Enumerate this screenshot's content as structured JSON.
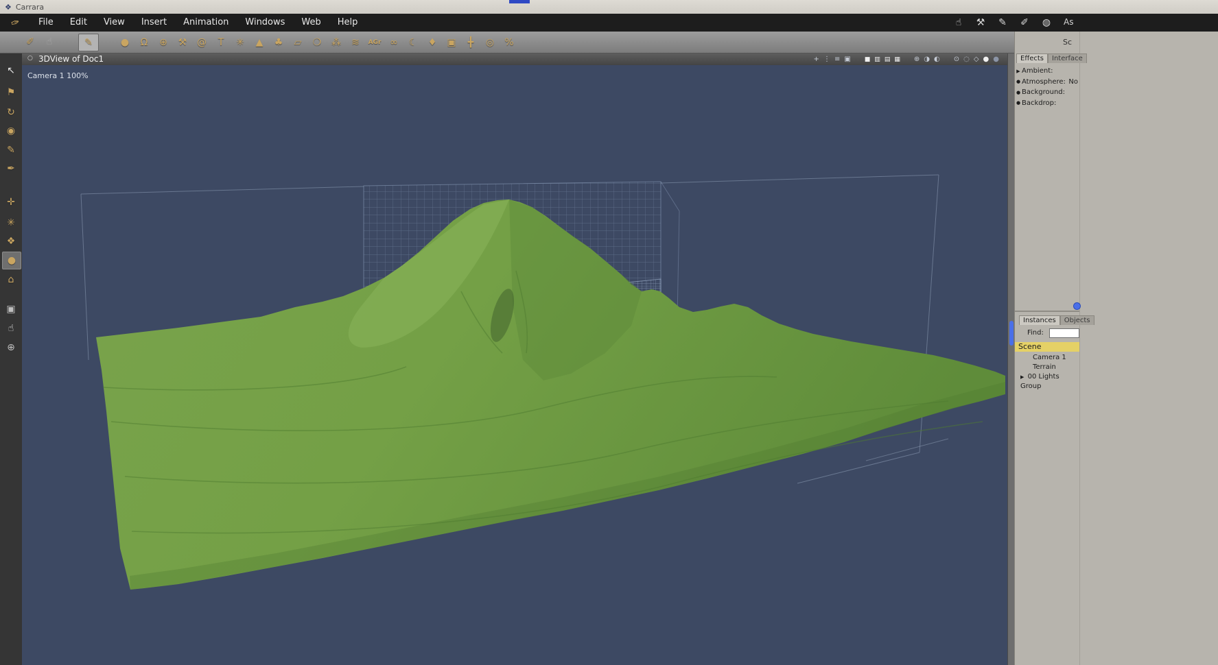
{
  "titlebar": {
    "title": "Carrara"
  },
  "menubar": {
    "brand_glyph": "✑",
    "items": [
      "File",
      "Edit",
      "View",
      "Insert",
      "Animation",
      "Windows",
      "Web",
      "Help"
    ],
    "room_label": "As",
    "room_icons": [
      {
        "name": "assemble-hand",
        "glyph": "☝"
      },
      {
        "name": "model-wrench",
        "glyph": "⚒"
      },
      {
        "name": "storyboard-pen",
        "glyph": "✎"
      },
      {
        "name": "texture-knife",
        "glyph": "✐"
      },
      {
        "name": "render-sphere",
        "glyph": "◍"
      }
    ]
  },
  "toolbar": {
    "edit_tools": [
      {
        "name": "wireframe-knife",
        "glyph": "✐"
      },
      {
        "name": "ghost-hand",
        "glyph": "☝"
      },
      {
        "name": "paint-brush",
        "glyph": "✎"
      }
    ],
    "tools": [
      {
        "name": "sphere-tool",
        "glyph": "●"
      },
      {
        "name": "vertical-object-tool",
        "glyph": "Ω"
      },
      {
        "name": "geodesic-tool",
        "glyph": "⊕"
      },
      {
        "name": "spline-tool",
        "glyph": "⚒"
      },
      {
        "name": "spiral-tool",
        "glyph": "@"
      },
      {
        "name": "text-tool",
        "glyph": "T"
      },
      {
        "name": "particle-tool",
        "glyph": "✳"
      },
      {
        "name": "terrain-tool",
        "glyph": "▲"
      },
      {
        "name": "plant-tool",
        "glyph": "♣"
      },
      {
        "name": "plane-tool",
        "glyph": "▱"
      },
      {
        "name": "ocean-tool",
        "glyph": "❍"
      },
      {
        "name": "rock-tool",
        "glyph": "⁂"
      },
      {
        "name": "cloud-tool",
        "glyph": "≋"
      },
      {
        "name": "agr-tool",
        "glyph": "AGr"
      },
      {
        "name": "metaball-tool",
        "glyph": "∞"
      },
      {
        "name": "shell-tool",
        "glyph": "☾"
      },
      {
        "name": "cone-tool",
        "glyph": "♦"
      },
      {
        "name": "camera-tool",
        "glyph": "▣"
      },
      {
        "name": "axes-tool",
        "glyph": "╋"
      },
      {
        "name": "target-tool",
        "glyph": "◎"
      },
      {
        "name": "bone-tool",
        "glyph": "%"
      }
    ]
  },
  "left_toolbar": [
    {
      "name": "select-arrow",
      "glyph": "↖"
    },
    {
      "name": "paint-flag",
      "glyph": "⚑"
    },
    {
      "name": "rotate-ring",
      "glyph": "↻"
    },
    {
      "name": "eye-sphere",
      "glyph": "◉"
    },
    {
      "name": "pen-tool",
      "glyph": "✎"
    },
    {
      "name": "screw-tool",
      "glyph": "✒"
    },
    {
      "name": "move-tool",
      "glyph": "✛"
    },
    {
      "name": "rotate-tool",
      "glyph": "✳"
    },
    {
      "name": "scale-tool",
      "glyph": "❖"
    },
    {
      "name": "sphere-mode",
      "glyph": "●"
    },
    {
      "name": "plane-mode",
      "glyph": "⌂"
    },
    {
      "name": "camera-mode",
      "glyph": "▣"
    },
    {
      "name": "pan-hand",
      "glyph": "☝"
    },
    {
      "name": "zoom-tool",
      "glyph": "⊕"
    }
  ],
  "viewport": {
    "title": "3DView of Doc1",
    "collapse_glyph": "○",
    "camera_label": "Camera 1 100%",
    "header_icons": [
      {
        "name": "production-frame-icon",
        "glyph": "+"
      },
      {
        "name": "aspect-ratio-icon",
        "glyph": "⋮"
      },
      {
        "name": "ruler-icon",
        "glyph": "≡"
      },
      {
        "name": "camera-icon",
        "glyph": "▣"
      },
      {
        "name": "layout-single-icon",
        "glyph": "■"
      },
      {
        "name": "layout-two-icon",
        "glyph": "▥"
      },
      {
        "name": "layout-three-icon",
        "glyph": "▤"
      },
      {
        "name": "layout-four-icon",
        "glyph": "▦"
      },
      {
        "name": "wireframe-sphere-icon",
        "glyph": "⊕"
      },
      {
        "name": "flat-shade-icon",
        "glyph": "◑"
      },
      {
        "name": "smooth-shade-icon",
        "glyph": "◐"
      },
      {
        "name": "rotate-view-icon",
        "glyph": "⊙"
      },
      {
        "name": "dotted-circle-icon",
        "glyph": "◌"
      },
      {
        "name": "bounding-box-icon",
        "glyph": "◇"
      },
      {
        "name": "white-sphere-icon",
        "glyph": "●"
      },
      {
        "name": "dark-sphere-icon",
        "glyph": "●"
      }
    ]
  },
  "tray": {
    "header": "Sc",
    "effects_tabs": [
      {
        "label": "Effects"
      },
      {
        "label": "Interface"
      }
    ],
    "properties": [
      {
        "marker": "▶",
        "label": "Ambient:",
        "value": ""
      },
      {
        "marker": "●",
        "label": "Atmosphere:",
        "value": "No"
      },
      {
        "marker": "●",
        "label": "Background:",
        "value": ""
      },
      {
        "marker": "●",
        "label": "Backdrop:",
        "value": ""
      }
    ],
    "browser_tabs": [
      {
        "label": "Instances"
      },
      {
        "label": "Objects"
      }
    ],
    "find_label": "Find:",
    "scene_root": "Scene",
    "scene_items": [
      {
        "arrow": "",
        "label": "Camera 1"
      },
      {
        "arrow": "",
        "label": "Terrain"
      },
      {
        "arrow": "▶",
        "label": "00 Lights Group"
      }
    ]
  },
  "colors": {
    "viewport_bg": "#3d4963",
    "terrain_green": "#6f9c43",
    "accent_blue": "#4a6fe8",
    "scene_highlight": "#e5d166"
  }
}
